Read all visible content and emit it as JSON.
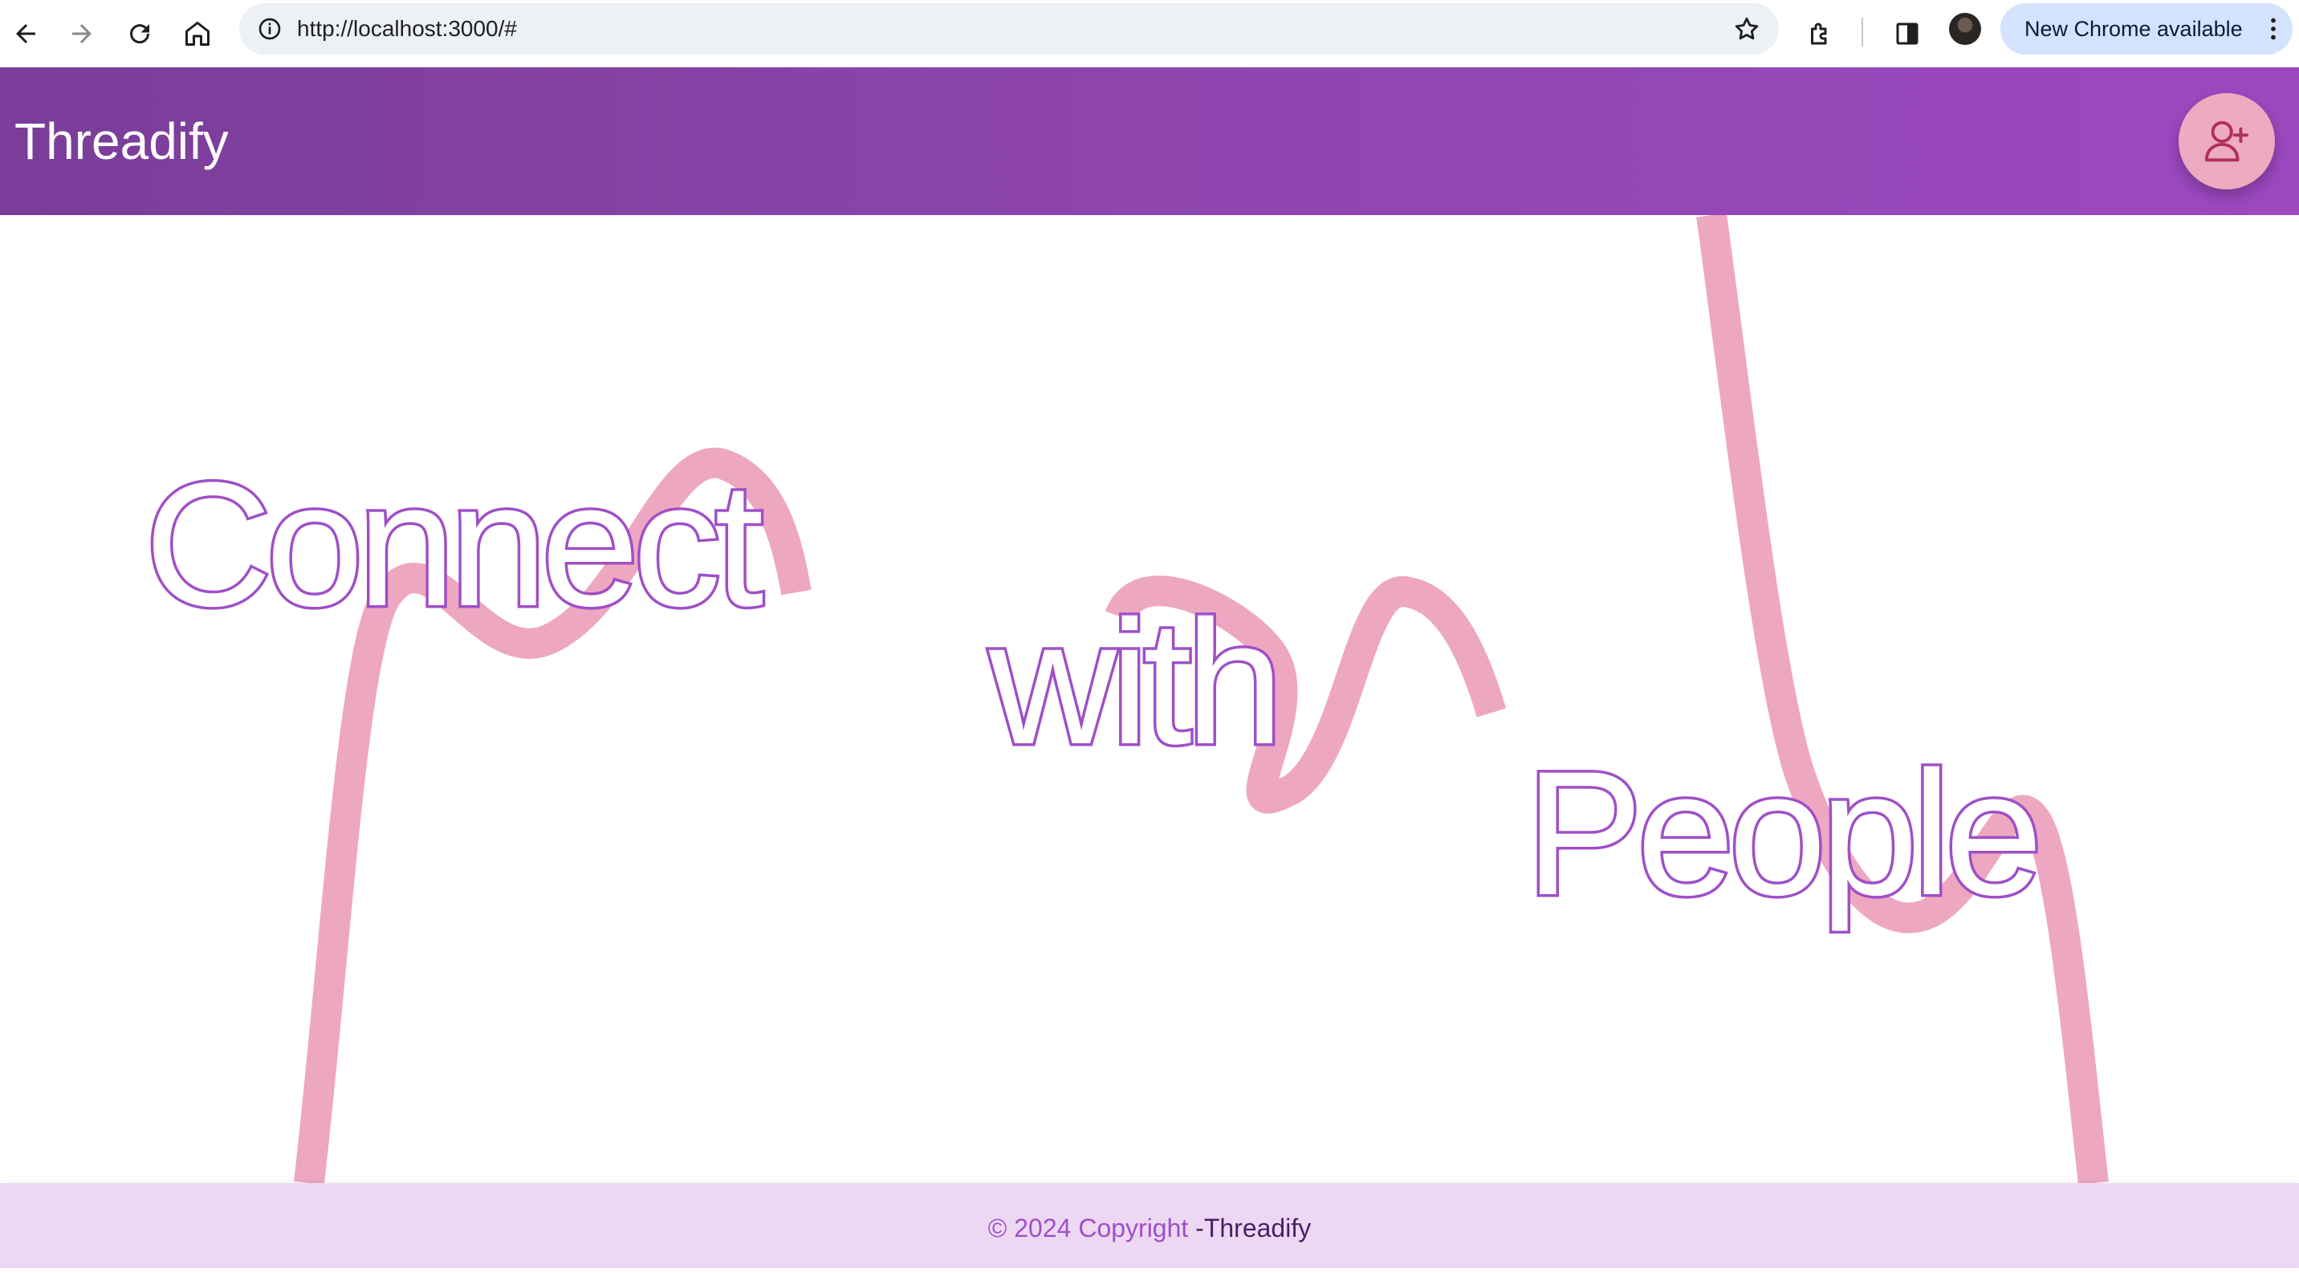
{
  "browser": {
    "url": "http://localhost:3000/#",
    "update_label": "New Chrome available",
    "icons": [
      "back-icon",
      "forward-icon",
      "reload-icon",
      "home-icon",
      "info-icon",
      "star-icon",
      "extensions-icon",
      "side-panel-icon",
      "profile-avatar",
      "menu-kebab-icon"
    ]
  },
  "header": {
    "brand": "Threadify",
    "action_icon": "add-user-icon"
  },
  "hero": {
    "words": [
      "Connect",
      "with",
      "People"
    ]
  },
  "footer": {
    "copyright": "© 2024 Copyright ",
    "brand": "-Threadify"
  },
  "colors": {
    "header_start": "#7a3d99",
    "header_end": "#9c49c0",
    "accent_purple": "#a04fc8",
    "wave_pink": "#eea7c0",
    "footer_bg": "#edd8f4"
  }
}
